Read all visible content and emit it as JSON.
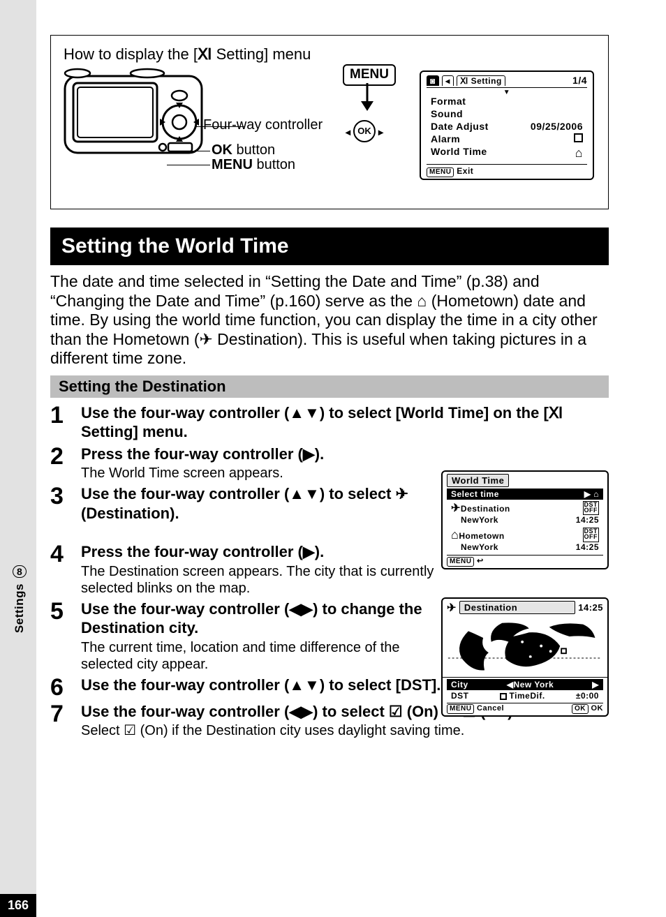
{
  "page_number": "166",
  "side_chapter_num": "8",
  "side_chapter_label": "Settings",
  "howto": {
    "title_prefix": "How to display the [",
    "title_suffix": " Setting] menu",
    "labels": {
      "four_way": "Four-way controller",
      "ok": "OK",
      "ok_suffix": " button",
      "menu": "MENU",
      "menu_suffix": " button"
    },
    "menu_button_label": "MENU",
    "ok_button_label": "OK"
  },
  "setting_screen": {
    "tab2_label": "Setting",
    "page_indicator": "1/4",
    "items": {
      "format": "Format",
      "sound": "Sound",
      "date_adjust": "Date Adjust",
      "date_value": "09/25/2006",
      "alarm": "Alarm",
      "world_time": "World Time"
    },
    "footer_label": "Exit",
    "footer_btn": "MENU"
  },
  "section_title": "Setting the World Time",
  "intro_text": "The date and time selected in “Setting the Date and Time” (p.38) and “Changing the Date and Time” (p.160) serve as the ⌂ (Hometown) date and time. By using the world time function, you can display the time in a city other than the Hometown (✈ Destination). This is useful when taking pictures in a different time zone.",
  "subsection_title": "Setting the Destination",
  "steps": {
    "s1": {
      "title_a": "Use the four-way controller (▲▼) to select [World Time] on the [",
      "title_b": " Setting] menu."
    },
    "s2": {
      "title": "Press the four-way controller (▶).",
      "desc": "The World Time screen appears."
    },
    "s3": {
      "title": "Use the four-way controller (▲▼) to select ✈ (Destination)."
    },
    "s4": {
      "title": "Press the four-way controller (▶).",
      "desc": "The Destination screen appears. The city that is currently selected blinks on the map."
    },
    "s5": {
      "title": "Use the four-way controller (◀▶) to change the Destination city.",
      "desc": "The current time, location and time difference of the selected city appear."
    },
    "s6": {
      "title": "Use the four-way controller (▲▼) to select [DST]."
    },
    "s7": {
      "title": "Use the four-way controller (◀▶) to select ☑ (On) or ☐ (Off).",
      "desc": "Select ☑ (On) if the Destination city uses daylight saving time."
    }
  },
  "wt_screen": {
    "title": "World Time",
    "select_time": "Select time",
    "destination_label": "Destination",
    "destination_city": "NewYork",
    "destination_time": "14:25",
    "hometown_label": "Hometown",
    "hometown_city": "NewYork",
    "hometown_time": "14:25",
    "footer_btn": "MENU",
    "dst_chip": "DST\nOFF"
  },
  "dest_screen": {
    "title": "Destination",
    "title_time": "14:25",
    "city_label": "City",
    "city_value": "New York",
    "dst_label": "DST",
    "timedif_label": "TimeDif.",
    "timedif_value": "±0:00",
    "cancel_btn": "MENU",
    "cancel_label": "Cancel",
    "ok_btn": "OK",
    "ok_label": "OK"
  }
}
